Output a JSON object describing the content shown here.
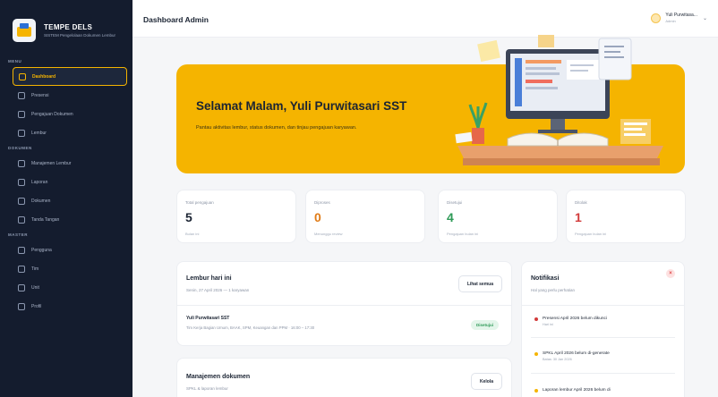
{
  "brand": {
    "title": "TEMPE DELS",
    "subtitle": "SISTEM Pengelolaan Dokumen Lembur"
  },
  "sidebar": {
    "sections": [
      {
        "label": "MENU",
        "items": [
          {
            "label": "Dashboard",
            "active": true,
            "icon": "home-icon"
          },
          {
            "label": "Presensi",
            "active": false,
            "icon": "calendar-icon"
          },
          {
            "label": "Pengajuan Dokumen",
            "active": false,
            "icon": "file-icon"
          },
          {
            "label": "Lembur",
            "active": false,
            "icon": "clock-icon"
          }
        ]
      },
      {
        "label": "DOKUMEN",
        "items": [
          {
            "label": "Manajemen Lembur",
            "active": false,
            "icon": "folder-icon"
          },
          {
            "label": "Laporan",
            "active": false,
            "icon": "report-icon"
          },
          {
            "label": "Dokumen",
            "active": false,
            "icon": "document-icon"
          },
          {
            "label": "Tanda Tangan",
            "active": false,
            "icon": "pen-icon"
          }
        ]
      },
      {
        "label": "MASTER",
        "items": [
          {
            "label": "Pengguna",
            "active": false,
            "icon": "user-icon"
          },
          {
            "label": "Tim",
            "active": false,
            "icon": "users-icon"
          },
          {
            "label": "Unit",
            "active": false,
            "icon": "building-icon"
          },
          {
            "label": "Profil",
            "active": false,
            "icon": "profile-icon"
          }
        ]
      }
    ]
  },
  "topbar": {
    "title": "Dashboard Admin",
    "user_name": "Yuli Purwitasa...",
    "user_role": "Admin"
  },
  "hero": {
    "title": "Selamat Malam, Yuli Purwitasari SST",
    "subtitle": "Pantau aktivitas lembur, status dokumen, dan tinjau pengajuan karyawan."
  },
  "stats": [
    {
      "label": "Total pengajuan",
      "value": "5",
      "sub": "Bulan ini",
      "color": "#1b2433"
    },
    {
      "label": "Diproses",
      "value": "0",
      "sub": "Menunggu review",
      "color": "#e07b16"
    },
    {
      "label": "Disetujui",
      "value": "4",
      "sub": "Pengajuan bulan ini",
      "color": "#2e9a57"
    },
    {
      "label": "Ditolak",
      "value": "1",
      "sub": "Pengajuan bulan ini",
      "color": "#d23b3b"
    }
  ],
  "lembur": {
    "title": "Lembur hari ini",
    "subtitle": "Senin, 27 April 2026 — 1 karyawan",
    "button": "Lihat semua",
    "row_name": "Yuli Purwitasari SST",
    "row_detail": "Tim Kerja Bagian Umum, BAAK, SPM, Keuangan dan PPM · 16:00 – 17:30",
    "badge": "Disetujui"
  },
  "dokumen": {
    "title": "Manajemen dokumen",
    "subtitle": "SPKL & laporan lembur",
    "button": "Kelola"
  },
  "notif": {
    "title": "Notifikasi",
    "subtitle": "Hal yang perlu perhatian",
    "close": "×",
    "items": [
      {
        "text": "Presensi April 2026 belum dikunci",
        "time": "Hari ini",
        "color": "#d23b3b"
      },
      {
        "text": "SPKL April 2026 belum di-generate",
        "time": "Batas: 30 Jan 2026",
        "color": "#f5b400"
      },
      {
        "text": "Laporan lembur April 2026 belum di",
        "time": "",
        "color": "#f5b400"
      }
    ]
  }
}
